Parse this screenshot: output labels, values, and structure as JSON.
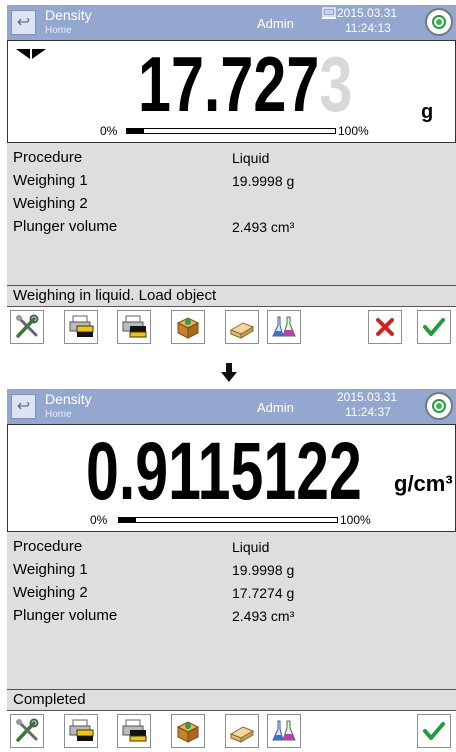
{
  "screens": [
    {
      "header": {
        "title": "Density",
        "subtitle": "Home",
        "user": "Admin",
        "date": "2015.03.31",
        "time": "11:24:13"
      },
      "display": {
        "value_main": "17.727",
        "value_dim": "3",
        "unit": "g",
        "scale_min": "0%",
        "scale_max": "100%",
        "progress": 0.08
      },
      "params": [
        {
          "label": "Procedure",
          "value": "Liquid"
        },
        {
          "label": "Weighing 1",
          "value": "19.9998 g"
        },
        {
          "label": "Weighing 2",
          "value": ""
        },
        {
          "label": "Plunger volume",
          "value": "2.493 cm³"
        }
      ],
      "message": "Weighing in liquid. Load object",
      "toolbar": [
        "tools-icon",
        "printer-header-icon",
        "printer-footer-icon",
        "database-box-icon",
        "eraser-tare-icon",
        "density-flasks-icon",
        "cancel-icon",
        "confirm-icon"
      ]
    },
    {
      "header": {
        "title": "Density",
        "subtitle": "Home",
        "user": "Admin",
        "date": "2015.03.31",
        "time": "11:24:37"
      },
      "display": {
        "value_main": "0.9115122",
        "value_dim": "",
        "unit": "g/cm³",
        "scale_min": "0%",
        "scale_max": "100%",
        "progress": 0.08
      },
      "params": [
        {
          "label": "Procedure",
          "value": "Liquid"
        },
        {
          "label": "Weighing 1",
          "value": "19.9998 g"
        },
        {
          "label": "Weighing 2",
          "value": "17.7274 g"
        },
        {
          "label": "Plunger volume",
          "value": "2.493 cm³"
        }
      ],
      "message": "Completed",
      "toolbar": [
        "tools-icon",
        "printer-header-icon",
        "printer-footer-icon",
        "database-box-icon",
        "eraser-tare-icon",
        "density-flasks-icon",
        "confirm-icon"
      ]
    }
  ],
  "colors": {
    "header_bg": "#94a8cf",
    "panel_bg": "#dedede",
    "confirm": "#1f9d3c",
    "cancel": "#d32020"
  }
}
